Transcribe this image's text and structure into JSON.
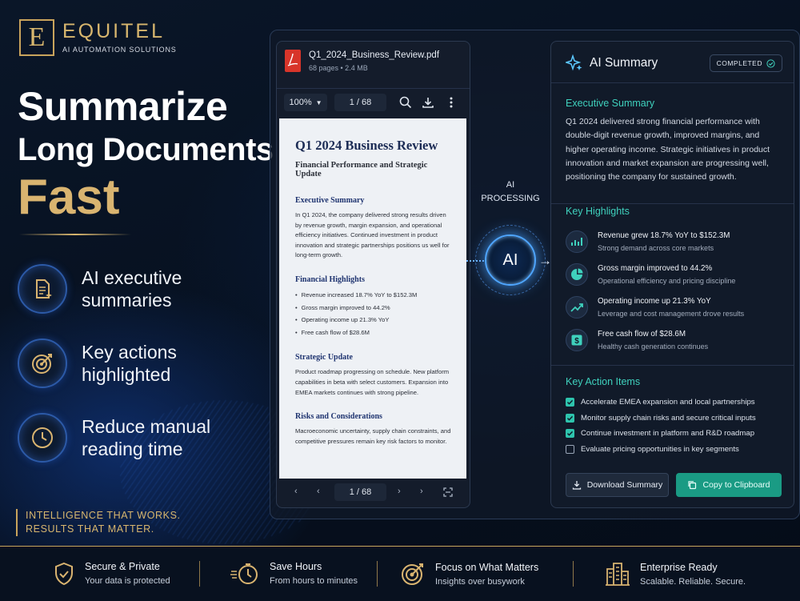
{
  "brand": {
    "letter": "E",
    "name": "EQUITEL",
    "subtitle": "AI AUTOMATION SOLUTIONS"
  },
  "headline": {
    "line1": "Summarize",
    "line2": "Long Documents",
    "line3": "Fast"
  },
  "features": [
    {
      "icon": "document-sparkle-icon",
      "label": "AI executive summaries"
    },
    {
      "icon": "target-icon",
      "label": "Key actions highlighted"
    },
    {
      "icon": "clock-icon",
      "label": "Reduce manual reading time"
    }
  ],
  "tagline": {
    "line1": "INTELLIGENCE THAT WORKS.",
    "line2": "RESULTS THAT MATTER."
  },
  "pdf": {
    "filename": "Q1_2024_Business_Review.pdf",
    "meta": "68 pages • 2.4 MB",
    "zoom": "100%",
    "page": "1 / 68",
    "doc": {
      "title": "Q1 2024 Business Review",
      "subtitle": "Financial Performance and Strategic Update",
      "sections": [
        {
          "heading": "Executive Summary",
          "text": "In Q1 2024, the company delivered strong results driven by revenue growth, margin expansion, and operational efficiency initiatives. Continued investment in product innovation and strategic partnerships positions us well for long-term growth."
        },
        {
          "heading": "Financial Highlights",
          "bullets": [
            "Revenue increased 18.7% YoY to $152.3M",
            "Gross margin improved to 44.2%",
            "Operating income up 21.3% YoY",
            "Free cash flow of $28.6M"
          ]
        },
        {
          "heading": "Strategic Update",
          "text": "Product roadmap progressing on schedule. New platform capabilities in beta with select customers. Expansion into EMEA markets continues with strong pipeline."
        },
        {
          "heading": "Risks and Considerations",
          "text": "Macroeconomic uncertainty, supply chain constraints, and competitive pressures remain key risk factors to monitor."
        }
      ]
    }
  },
  "ai": {
    "label1": "AI",
    "label2": "PROCESSING",
    "badge": "AI"
  },
  "summary": {
    "title": "AI Summary",
    "status": "COMPLETED",
    "exec_title": "Executive Summary",
    "exec_text": "Q1 2024 delivered strong financial performance with double-digit revenue growth, improved margins, and higher operating income. Strategic initiatives in product innovation and market expansion are progressing well, positioning the company for sustained growth.",
    "highlights_title": "Key Highlights",
    "highlights": [
      {
        "icon": "bar-chart-icon",
        "title": "Revenue grew 18.7% YoY to $152.3M",
        "sub": "Strong demand across core markets"
      },
      {
        "icon": "pie-chart-icon",
        "title": "Gross margin improved to 44.2%",
        "sub": "Operational efficiency and pricing discipline"
      },
      {
        "icon": "trend-up-icon",
        "title": "Operating income up 21.3% YoY",
        "sub": "Leverage and cost management drove results"
      },
      {
        "icon": "dollar-icon",
        "title": "Free cash flow of $28.6M",
        "sub": "Healthy cash generation continues"
      }
    ],
    "actions_title": "Key Action Items",
    "actions": [
      {
        "label": "Accelerate EMEA expansion and local partnerships",
        "checked": true
      },
      {
        "label": "Monitor supply chain risks and secure critical inputs",
        "checked": true
      },
      {
        "label": "Continue investment in platform and R&D roadmap",
        "checked": true
      },
      {
        "label": "Evaluate pricing opportunities in key segments",
        "checked": false
      }
    ],
    "download_label": "Download Summary",
    "copy_label": "Copy to Clipboard"
  },
  "bottom": [
    {
      "icon": "shield-check-icon",
      "title": "Secure & Private",
      "sub": "Your data is protected"
    },
    {
      "icon": "stopwatch-icon",
      "title": "Save Hours",
      "sub": "From hours to minutes"
    },
    {
      "icon": "target-icon",
      "title": "Focus on What Matters",
      "sub": "Insights over busywork"
    },
    {
      "icon": "building-icon",
      "title": "Enterprise Ready",
      "sub": "Scalable. Reliable. Secure."
    }
  ],
  "colors": {
    "gold": "#d9b470",
    "teal": "#3fd1bd",
    "accent_blue": "#4fa6ff",
    "copy_button": "#1a9b84"
  }
}
